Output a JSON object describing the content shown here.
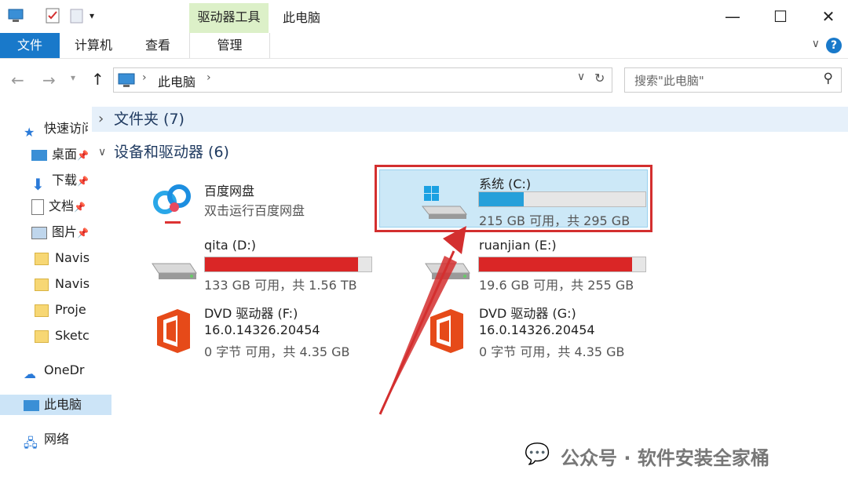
{
  "window": {
    "title": "此电脑",
    "context_tab": "驱动器工具"
  },
  "ribbon": {
    "tabs": [
      "文件",
      "计算机",
      "查看",
      "管理"
    ]
  },
  "address": {
    "path": "此电脑",
    "search_placeholder": "搜索\"此电脑\""
  },
  "sidebar": {
    "items": [
      {
        "label": "快速访问",
        "icon": "star-icon"
      },
      {
        "label": "桌面",
        "icon": "desktop-icon"
      },
      {
        "label": "下载",
        "icon": "download-icon"
      },
      {
        "label": "文档",
        "icon": "document-icon"
      },
      {
        "label": "图片",
        "icon": "picture-icon"
      },
      {
        "label": "Navis",
        "icon": "folder-icon"
      },
      {
        "label": "Navis",
        "icon": "folder-icon"
      },
      {
        "label": "Proje",
        "icon": "folder-icon"
      },
      {
        "label": "Sketc",
        "icon": "folder-icon"
      },
      {
        "label": "OneDr",
        "icon": "onedrive-icon"
      },
      {
        "label": "此电脑",
        "icon": "computer-icon"
      },
      {
        "label": "网络",
        "icon": "network-icon"
      }
    ]
  },
  "groups": {
    "folders": "文件夹 (7)",
    "devices": "设备和驱动器 (6)"
  },
  "drives": [
    {
      "name": "百度网盘",
      "sub": "双击运行百度网盘",
      "icon": "baidu-netdisk-icon"
    },
    {
      "name": "系统 (C:)",
      "sub": "215 GB 可用，共 295 GB",
      "icon": "windows-drive-icon",
      "used_fraction": 0.27,
      "bar_color": "#26a0da"
    },
    {
      "name": "qita (D:)",
      "sub": "133 GB 可用，共 1.56 TB",
      "icon": "hard-drive-icon",
      "used_fraction": 0.92,
      "bar_color": "#da2626"
    },
    {
      "name": "ruanjian (E:)",
      "sub": "19.6 GB 可用，共 255 GB",
      "icon": "hard-drive-icon",
      "used_fraction": 0.92,
      "bar_color": "#da2626"
    },
    {
      "name": "DVD 驱动器 (F:)",
      "sub": "16.0.14326.20454",
      "sub2": "0 字节 可用，共 4.35 GB",
      "icon": "office-icon"
    },
    {
      "name": "DVD 驱动器 (G:)",
      "sub": "16.0.14326.20454",
      "sub2": "0 字节 可用，共 4.35 GB",
      "icon": "office-icon"
    }
  ],
  "watermark": "公众号 · 软件安装全家桶",
  "colors": {
    "accent": "#1979ca",
    "highlight": "#d32f2f",
    "selection": "#cce8f7"
  }
}
